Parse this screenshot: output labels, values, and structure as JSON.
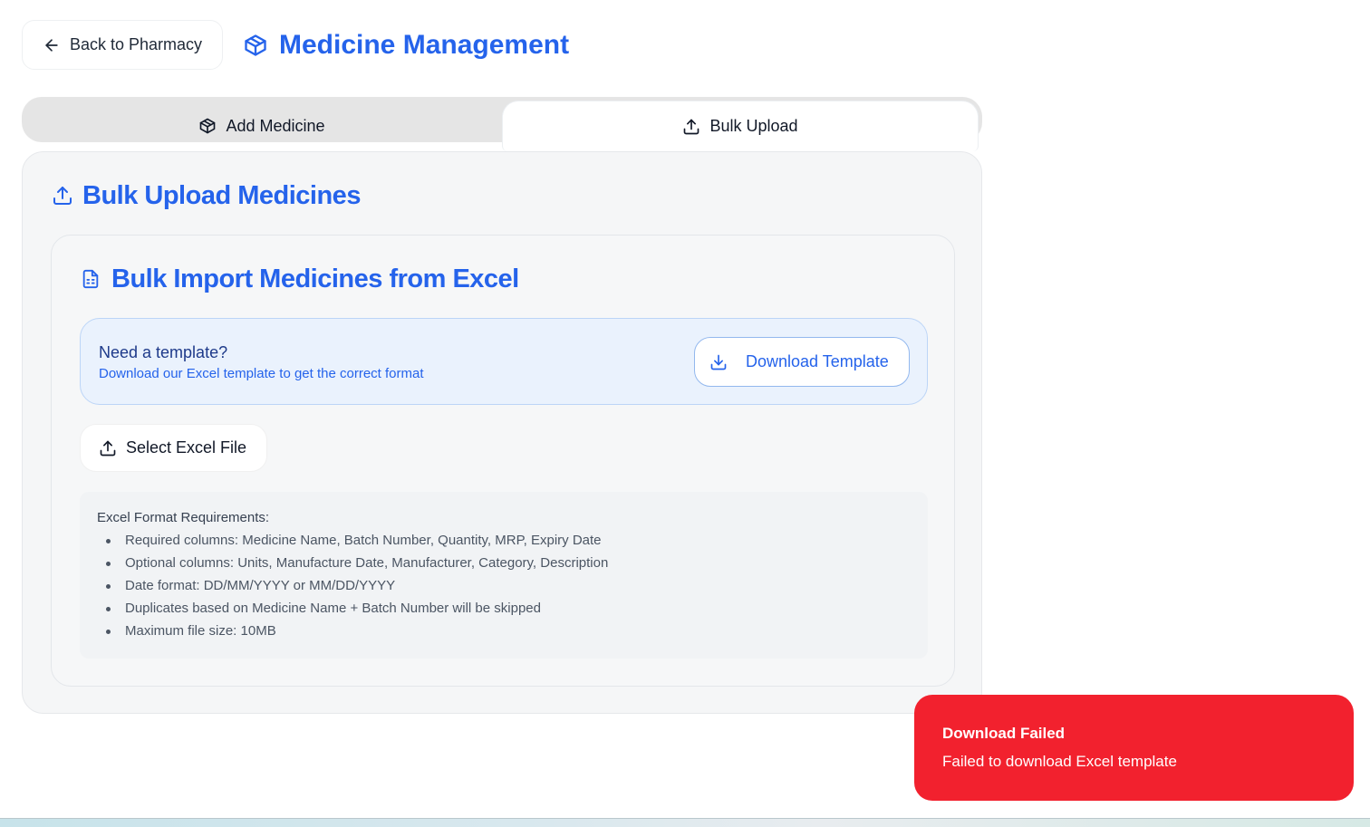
{
  "header": {
    "back_label": "Back to Pharmacy",
    "title": "Medicine Management"
  },
  "tabs": [
    {
      "label": "Add Medicine",
      "icon": "package-icon",
      "active": false
    },
    {
      "label": "Bulk Upload",
      "icon": "upload-icon",
      "active": true
    }
  ],
  "bulk": {
    "section_title": "Bulk Upload Medicines",
    "import_title": "Bulk Import Medicines from Excel",
    "template": {
      "heading": "Need a template?",
      "subtext": "Download our Excel template to get the correct format",
      "button_label": "Download Template"
    },
    "select_label": "Select Excel File",
    "requirements": {
      "title": "Excel Format Requirements:",
      "items": [
        "Required columns: Medicine Name, Batch Number, Quantity, MRP, Expiry Date",
        "Optional columns: Units, Manufacture Date, Manufacturer, Category, Description",
        "Date format: DD/MM/YYYY or MM/DD/YYYY",
        "Duplicates based on Medicine Name + Batch Number will be skipped",
        "Maximum file size: 10MB"
      ]
    }
  },
  "toast": {
    "title": "Download Failed",
    "description": "Failed to download Excel template",
    "color": "#f2212e"
  },
  "colors": {
    "accent": "#2563eb",
    "error": "#f2212e"
  }
}
